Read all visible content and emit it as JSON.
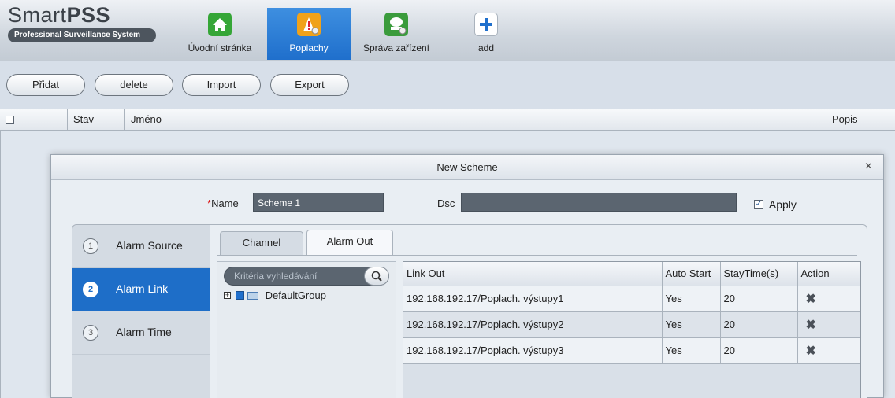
{
  "app": {
    "logo_title_a": "Smart",
    "logo_title_b": "PSS",
    "logo_subtitle": "Professional Surveillance System"
  },
  "nav": [
    {
      "label": "Úvodní stránka",
      "icon": "home-icon"
    },
    {
      "label": "Poplachy",
      "icon": "alarm-icon"
    },
    {
      "label": "Správa zařízení",
      "icon": "device-manager-icon"
    },
    {
      "label": "add",
      "icon": "plus-icon"
    }
  ],
  "toolbar": {
    "add": "Přidat",
    "delete": "delete",
    "import": "Import",
    "export": "Export"
  },
  "table": {
    "col_status": "Stav",
    "col_name": "Jméno",
    "col_desc": "Popis"
  },
  "dialog": {
    "title": "New Scheme",
    "close": "×",
    "name_required": "*",
    "name_label": "Name",
    "name_value": "Scheme 1",
    "dsc_label": "Dsc",
    "dsc_value": "",
    "apply_label": "Apply",
    "apply_checked": true
  },
  "steps": [
    {
      "num": "1",
      "label": "Alarm Source"
    },
    {
      "num": "2",
      "label": "Alarm Link"
    },
    {
      "num": "3",
      "label": "Alarm Time"
    }
  ],
  "tabs": {
    "channel": "Channel",
    "alarm_out": "Alarm Out"
  },
  "search": {
    "placeholder": "Kritéria vyhledávání"
  },
  "tree": {
    "expand": "+",
    "group": "DefaultGroup"
  },
  "link_table": {
    "headers": [
      "Link Out",
      "Auto Start",
      "StayTime(s)",
      "Action"
    ],
    "rows": [
      {
        "link_out": "192.168.192.17/Poplach. výstupy1",
        "auto_start": "Yes",
        "stay_time": "20"
      },
      {
        "link_out": "192.168.192.17/Poplach. výstupy2",
        "auto_start": "Yes",
        "stay_time": "20"
      },
      {
        "link_out": "192.168.192.17/Poplach. výstupy3",
        "auto_start": "Yes",
        "stay_time": "20"
      }
    ]
  },
  "colors": {
    "accent": "#1e6ec8",
    "alarm_icon_bg": "#f0a21a",
    "home_icon_bg": "#35a637",
    "device_icon_bg": "#3a9b3c",
    "add_icon_bg": "#ffffff"
  }
}
